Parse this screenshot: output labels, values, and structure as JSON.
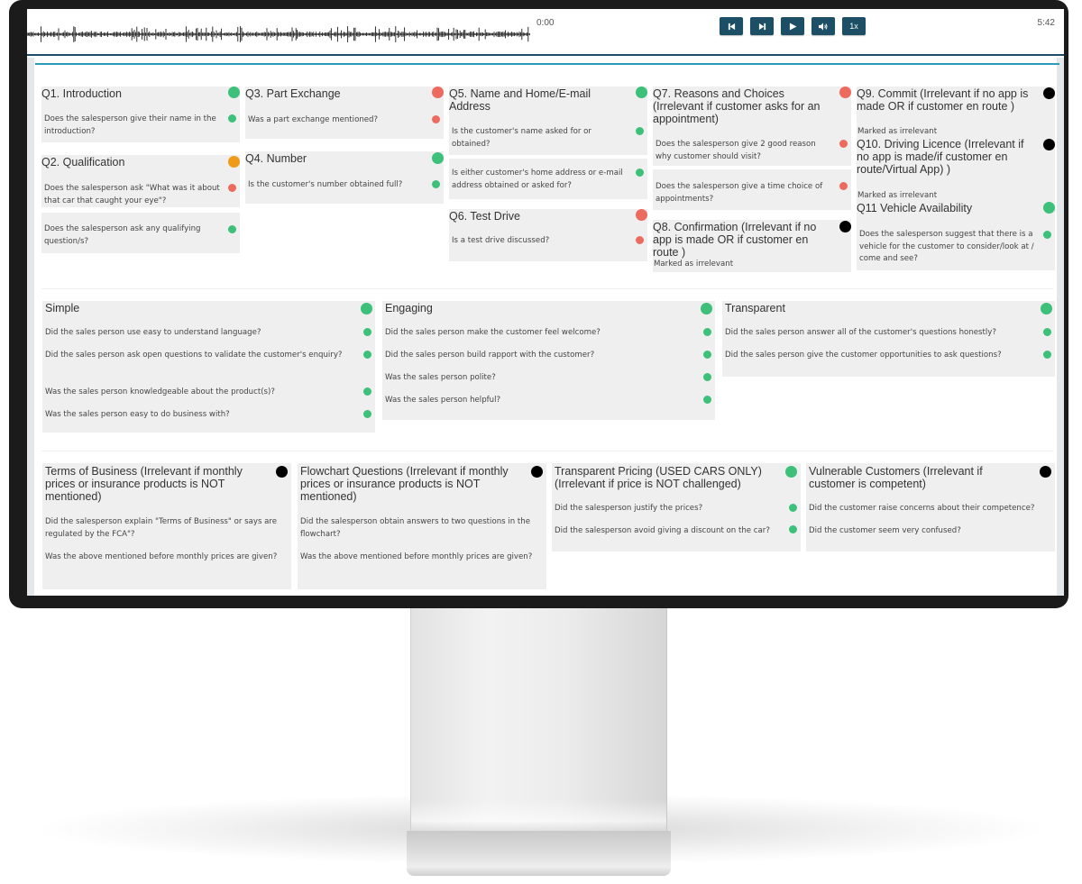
{
  "colors": {
    "pass": "#3cc07a",
    "fail": "#ec6b5e",
    "partial": "#f09a1a",
    "irrelevant": "#000000",
    "player_button": "#1c4e66",
    "accent": "#2a9bb8"
  },
  "player": {
    "time_current": "0:00",
    "time_total": "5:42",
    "buttons": [
      {
        "name": "skip-back",
        "icon": "skip-back-icon",
        "glyph": "⏮"
      },
      {
        "name": "skip-forward",
        "icon": "skip-forward-icon",
        "glyph": "⏭"
      },
      {
        "name": "play",
        "icon": "play-icon",
        "glyph": "▶"
      },
      {
        "name": "volume",
        "icon": "volume-icon",
        "glyph": "🔈"
      },
      {
        "name": "speed",
        "label": "1x"
      }
    ]
  },
  "sections": {
    "q1": {
      "title": "Q1. Introduction",
      "status": "pass",
      "questions": [
        {
          "text": "Does the salesperson give their name in the introduction?",
          "status": "pass"
        }
      ]
    },
    "q2": {
      "title": "Q2. Qualification",
      "status": "partial",
      "questions": [
        {
          "text": "Does the salesperson ask \"What was it about that car that caught your eye\"?",
          "status": "fail"
        },
        {
          "text": "Does the salesperson ask any qualifying question/s?",
          "status": "pass"
        }
      ]
    },
    "q3": {
      "title": "Q3. Part Exchange",
      "status": "fail",
      "questions": [
        {
          "text": "Was a part exchange mentioned?",
          "status": "fail"
        }
      ]
    },
    "q4": {
      "title": "Q4. Number",
      "status": "pass",
      "questions": [
        {
          "text": "Is the customer's number obtained full?",
          "status": "pass"
        }
      ]
    },
    "q5": {
      "title": "Q5. Name and Home/E-mail Address",
      "status": "pass",
      "questions": [
        {
          "text": "Is the customer's name asked for or obtained?",
          "status": "pass"
        },
        {
          "text": "Is either customer's home address or e-mail address obtained or asked for?",
          "status": "pass"
        }
      ]
    },
    "q6": {
      "title": "Q6. Test Drive",
      "status": "fail",
      "questions": [
        {
          "text": "Is a test drive discussed?",
          "status": "fail"
        }
      ]
    },
    "q7": {
      "title": "Q7. Reasons and Choices (Irrelevant if customer asks for an appointment)",
      "status": "fail",
      "questions": [
        {
          "text": "Does the salesperson give 2 good reason why customer should visit?",
          "status": "fail"
        },
        {
          "text": "Does the salesperson give a time choice of appointments?",
          "status": "fail"
        }
      ]
    },
    "q8": {
      "title": "Q8. Confirmation (Irrelevant if no app is made OR if customer en route )",
      "status": "irrelevant",
      "note": "Marked as irrelevant"
    },
    "q9": {
      "title": "Q9. Commit (Irrelevant if no app is made OR if customer en route )",
      "status": "irrelevant",
      "note": "Marked as irrelevant"
    },
    "q10": {
      "title": "Q10. Driving Licence (Irrelevant if no app is made/if customer en route/Virtual App) )",
      "status": "irrelevant",
      "note": "Marked as irrelevant"
    },
    "q11": {
      "title": "Q11 Vehicle Availability",
      "status": "pass",
      "questions": [
        {
          "text": "Does the salesperson suggest that there is a vehicle for the customer to consider/look at / come and see?",
          "status": "pass"
        }
      ]
    },
    "simple": {
      "title": "Simple",
      "status": "pass",
      "questions": [
        {
          "text": "Did the sales person use easy to understand language?",
          "status": "pass"
        },
        {
          "text": "Did the sales person ask open questions to validate the customer's enquiry?",
          "status": "pass"
        },
        {
          "text": "Was the sales person knowledgeable about the product(s)?",
          "status": "pass"
        },
        {
          "text": "Was the sales person easy to do business with?",
          "status": "pass"
        }
      ]
    },
    "engaging": {
      "title": "Engaging",
      "status": "pass",
      "questions": [
        {
          "text": "Did the sales person make the customer feel welcome?",
          "status": "pass"
        },
        {
          "text": "Did the sales person build rapport with the customer?",
          "status": "pass"
        },
        {
          "text": "Was the sales person polite?",
          "status": "pass"
        },
        {
          "text": "Was the sales person helpful?",
          "status": "pass"
        }
      ]
    },
    "transparent": {
      "title": "Transparent",
      "status": "pass",
      "questions": [
        {
          "text": "Did the sales person answer all of the customer's questions honestly?",
          "status": "pass"
        },
        {
          "text": "Did the sales person give the customer opportunities to ask questions?",
          "status": "pass"
        }
      ]
    },
    "terms": {
      "title": "Terms of Business (Irrelevant if monthly prices or insurance products is NOT mentioned)",
      "status": "irrelevant",
      "questions": [
        {
          "text": "Did the salesperson explain \"Terms of Business\" or says are regulated by the FCA\"?"
        },
        {
          "text": "Was the above mentioned before monthly prices are given?"
        }
      ]
    },
    "flowchart": {
      "title": "Flowchart Questions (Irrelevant if monthly prices or insurance products is NOT mentioned)",
      "status": "irrelevant",
      "questions": [
        {
          "text": "Did the salesperson obtain answers to two questions in the flowchart?"
        },
        {
          "text": "Was the above mentioned before monthly prices are given?"
        }
      ]
    },
    "pricing": {
      "title": "Transparent Pricing (USED CARS ONLY) (Irrelevant if price is NOT challenged)",
      "status": "pass",
      "questions": [
        {
          "text": "Did the salesperson justify the prices?",
          "status": "pass"
        },
        {
          "text": "Did the salesperson avoid giving a discount on the car?",
          "status": "pass"
        }
      ]
    },
    "vulnerable": {
      "title": "Vulnerable Customers (Irrelevant if customer is competent)",
      "status": "irrelevant",
      "questions": [
        {
          "text": "Did the customer raise concerns about their competence?"
        },
        {
          "text": "Did the customer seem very confused?"
        }
      ]
    }
  }
}
